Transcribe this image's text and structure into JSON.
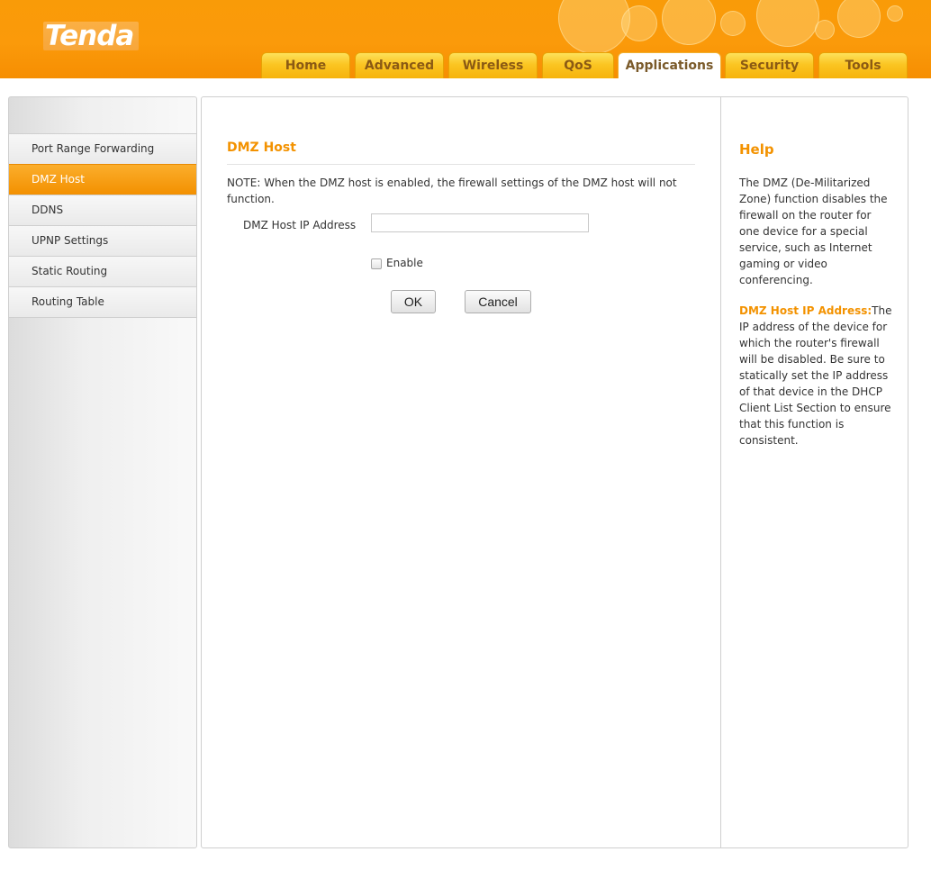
{
  "brand": {
    "logo": "Tenda"
  },
  "nav": {
    "tabs": [
      {
        "label": "Home"
      },
      {
        "label": "Advanced"
      },
      {
        "label": "Wireless"
      },
      {
        "label": "QoS"
      },
      {
        "label": "Applications"
      },
      {
        "label": "Security"
      },
      {
        "label": "Tools"
      }
    ],
    "active_tab": "Applications"
  },
  "sidebar": {
    "items": [
      {
        "label": "Port Range Forwarding"
      },
      {
        "label": "DMZ Host"
      },
      {
        "label": "DDNS"
      },
      {
        "label": "UPNP Settings"
      },
      {
        "label": "Static Routing"
      },
      {
        "label": "Routing Table"
      }
    ],
    "active_item": "DMZ Host"
  },
  "main": {
    "title": "DMZ Host",
    "note": "NOTE: When the DMZ host is enabled, the firewall settings of the DMZ host will not function.",
    "ip_field": {
      "label": "DMZ Host IP Address",
      "value": ""
    },
    "enable": {
      "label": "Enable",
      "checked": false
    },
    "ok_label": "OK",
    "cancel_label": "Cancel"
  },
  "help": {
    "title": "Help",
    "intro": "The DMZ (De-Militarized Zone) function disables the firewall on the router for one device for a special service, such as Internet gaming or video conferencing.",
    "term": "DMZ Host IP Address:",
    "term_desc": "The IP address of the device for which the router's firewall will be disabled. Be sure to statically set the IP address of that device in the DHCP Client List Section to ensure that this function is consistent."
  },
  "colors": {
    "header_orange": "#f99b08",
    "accent_orange": "#f39200",
    "tab_yellow": "#fbc522",
    "tab_text": "#8b5a14"
  }
}
